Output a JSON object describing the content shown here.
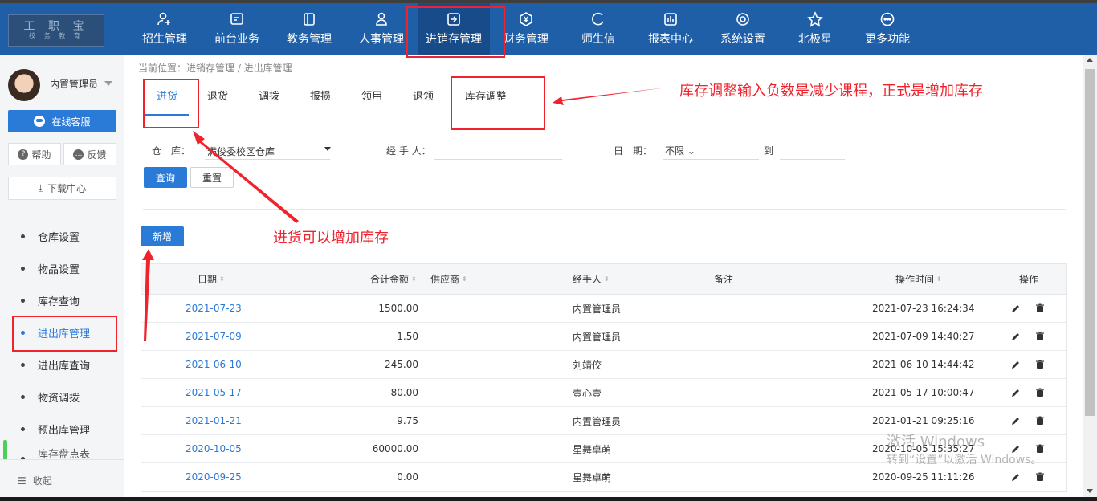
{
  "logo": {
    "line1": "工 职 宝",
    "line2": "校 务 教 育"
  },
  "nav": [
    {
      "label": "招生管理",
      "icon": "user-plus-icon"
    },
    {
      "label": "前台业务",
      "icon": "monitor-icon"
    },
    {
      "label": "教务管理",
      "icon": "book-icon"
    },
    {
      "label": "人事管理",
      "icon": "person-icon"
    },
    {
      "label": "进销存管理",
      "icon": "box-arrow-icon",
      "active": true
    },
    {
      "label": "财务管理",
      "icon": "yen-icon"
    },
    {
      "label": "师生信",
      "icon": "chat-icon"
    },
    {
      "label": "报表中心",
      "icon": "chart-icon"
    },
    {
      "label": "系统设置",
      "icon": "gear-icon"
    },
    {
      "label": "北极星",
      "icon": "star-icon"
    },
    {
      "label": "更多功能",
      "icon": "more-icon"
    }
  ],
  "user": {
    "name": "内置管理员"
  },
  "sidebar": {
    "kefu": "在线客服",
    "help": "帮助",
    "feedback": "反馈",
    "download": "下载中心",
    "items": [
      "仓库设置",
      "物品设置",
      "库存查询",
      "进出库管理",
      "进出库查询",
      "物资调拨",
      "预出库管理",
      "库存盘点表"
    ],
    "active_index": 3,
    "collapse": "收起"
  },
  "breadcrumb": "当前位置：进销存管理 / 进出库管理",
  "tabs": [
    "进货",
    "退货",
    "调拨",
    "报损",
    "领用",
    "退领",
    "库存调整"
  ],
  "filters": {
    "warehouse_label": "仓　库：",
    "warehouse_value": "满俊委校区仓库",
    "handler_label": "经 手 人：",
    "handler_value": "",
    "date_label": "日　期：",
    "date_value": "不限",
    "to_label": "到",
    "query_btn": "查询",
    "reset_btn": "重置"
  },
  "add_btn": "新增",
  "table": {
    "headers": {
      "date": "日期",
      "amount": "合计金额",
      "supplier": "供应商",
      "handler": "经手人",
      "remark": "备注",
      "optime": "操作时间",
      "ops": "操作"
    },
    "rows": [
      {
        "date": "2021-07-23",
        "amount": "1500.00",
        "supplier": "",
        "handler": "内置管理员",
        "remark": "",
        "optime": "2021-07-23 16:24:34"
      },
      {
        "date": "2021-07-09",
        "amount": "1.50",
        "supplier": "",
        "handler": "内置管理员",
        "remark": "",
        "optime": "2021-07-09 14:40:27"
      },
      {
        "date": "2021-06-10",
        "amount": "245.00",
        "supplier": "",
        "handler": "刘靖佼",
        "remark": "",
        "optime": "2021-06-10 14:44:42"
      },
      {
        "date": "2021-05-17",
        "amount": "80.00",
        "supplier": "",
        "handler": "壹心壹",
        "remark": "",
        "optime": "2021-05-17 10:00:47"
      },
      {
        "date": "2021-01-21",
        "amount": "9.75",
        "supplier": "",
        "handler": "内置管理员",
        "remark": "",
        "optime": "2021-01-21 09:25:16"
      },
      {
        "date": "2020-10-05",
        "amount": "60000.00",
        "supplier": "",
        "handler": "星舞卓萌",
        "remark": "",
        "optime": "2020-10-05 15:35:27"
      },
      {
        "date": "2020-09-25",
        "amount": "0.00",
        "supplier": "",
        "handler": "星舞卓萌",
        "remark": "",
        "optime": "2020-09-25 11:11:26"
      }
    ]
  },
  "annotations": {
    "adjust_note": "库存调整输入负数是减少课程，正式是增加库存",
    "purchase_note": "进货可以增加库存",
    "color": "#f0232d"
  },
  "watermark": {
    "line1": "激活 Windows",
    "line2": "转到“设置”以激活 Windows。"
  }
}
